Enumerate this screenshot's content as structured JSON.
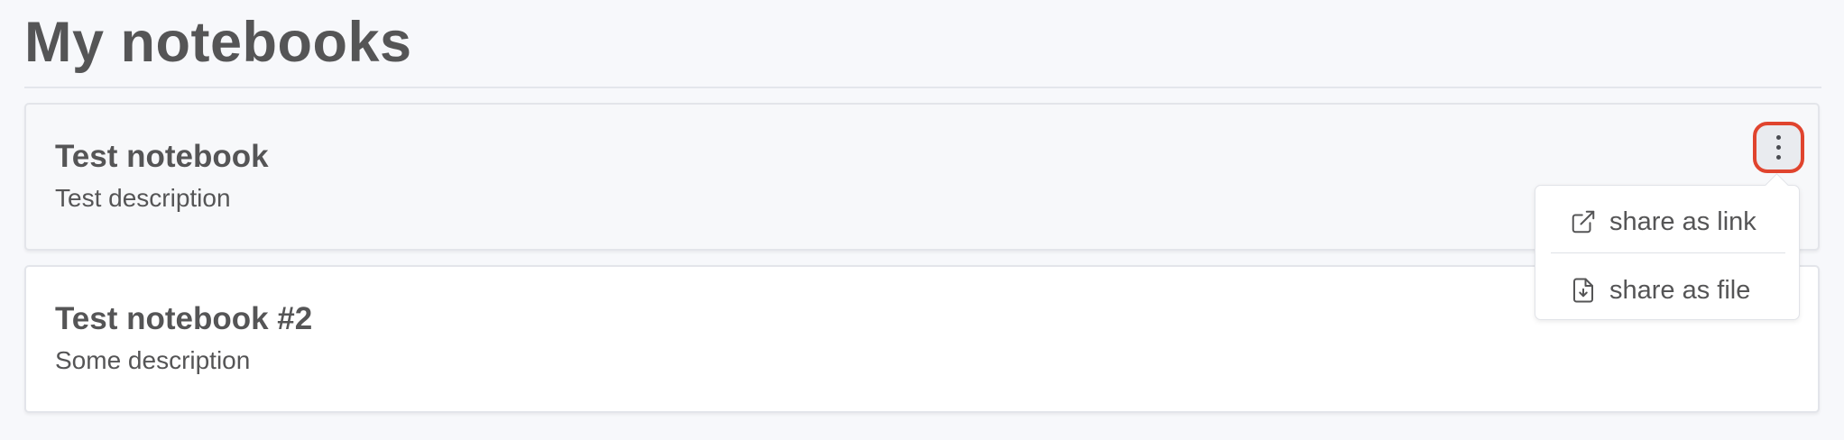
{
  "page": {
    "title": "My notebooks"
  },
  "notebooks": [
    {
      "title": "Test notebook",
      "description": "Test description"
    },
    {
      "title": "Test notebook #2",
      "description": "Some description"
    }
  ],
  "menu": {
    "trigger_icon": "more-vertical-icon",
    "items": [
      {
        "label": "share as link",
        "icon": "external-link-icon"
      },
      {
        "label": "share as file",
        "icon": "file-download-icon"
      }
    ]
  },
  "colors": {
    "text": "#555556",
    "focus_outline": "#e0442e",
    "background": "#f7f8fb"
  }
}
